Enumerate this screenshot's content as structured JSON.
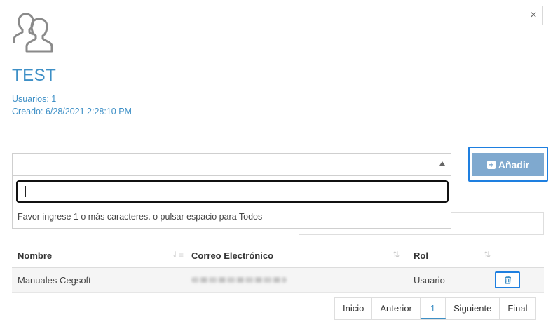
{
  "modal": {
    "close_label": "×"
  },
  "group": {
    "icon": "users-icon",
    "name": "TEST",
    "users_text": "Usuarios: 1",
    "created_text": "Creado: 6/28/2021 2:28:10 PM"
  },
  "selector": {
    "search_value": "",
    "hint": "Favor ingrese 1 o más caracteres. o pulsar espacio para Todos"
  },
  "add_button": {
    "label": "Añadir",
    "icon": "plus-square-icon"
  },
  "table": {
    "columns": [
      {
        "label": "Nombre",
        "sort_icon": "sort-alpha-icon"
      },
      {
        "label": "Correo Electrónico",
        "sort_icon": "sort-icon"
      },
      {
        "label": "Rol",
        "sort_icon": "sort-icon"
      }
    ],
    "rows": [
      {
        "name": "Manuales Cegsoft",
        "email": "",
        "role": "Usuario",
        "action_icon": "trash-icon"
      }
    ]
  },
  "pagination": {
    "first": "Inicio",
    "prev": "Anterior",
    "current": "1",
    "next": "Siguiente",
    "last": "Final"
  },
  "colors": {
    "accent": "#3d8fc6",
    "button": "#7fa9cf",
    "focus_outline": "#1e7fe0"
  }
}
